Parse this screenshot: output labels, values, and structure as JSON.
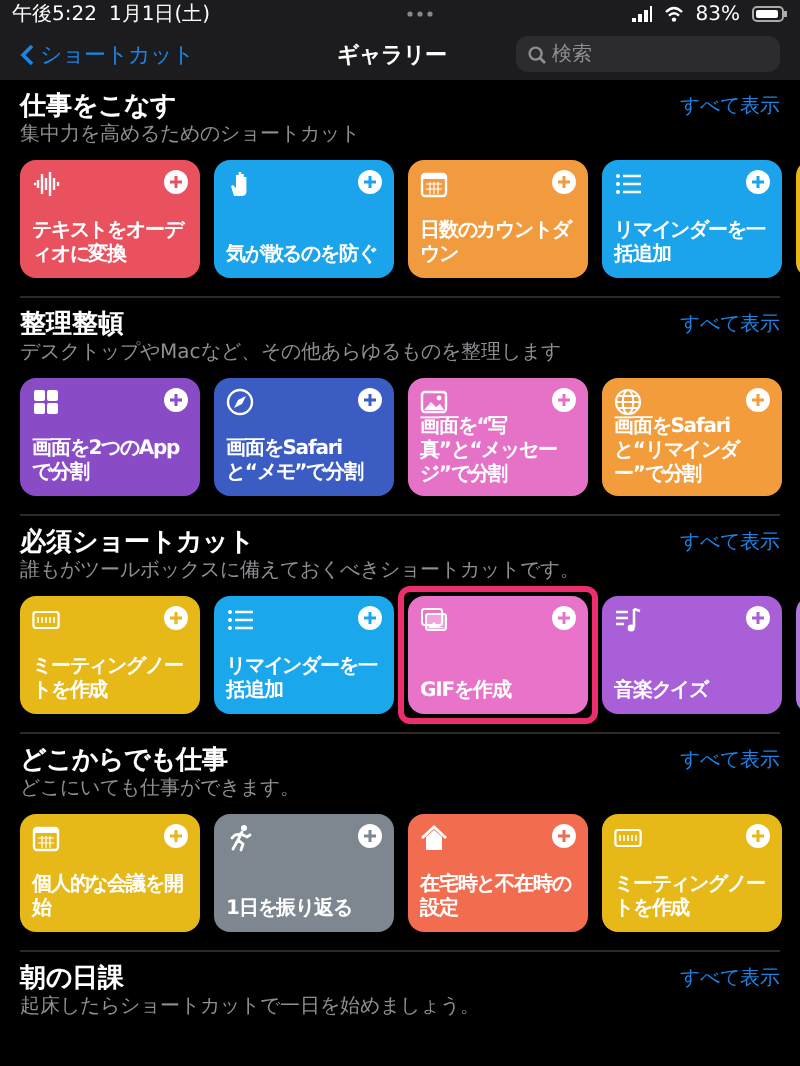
{
  "status_bar": {
    "time": "午後5:22",
    "date": "1月1日(土)",
    "battery": "83%"
  },
  "nav": {
    "back": "ショートカット",
    "title": "ギャラリー",
    "search": {
      "placeholder": "検索"
    }
  },
  "sections": [
    {
      "title": "仕事をこなす",
      "subtitle": "集中力を高めるためのショートカット",
      "see_all": "すべて表示",
      "cards": [
        {
          "kind": "full",
          "title": "テキストをオーディオに変換",
          "color": "#e9515e",
          "highlighted": false
        },
        {
          "kind": "full",
          "title": "気が散るのを防ぐ",
          "color": "#1ba4ec",
          "highlighted": false
        },
        {
          "kind": "full",
          "title": "日数のカウントダウン",
          "color": "#f19a3e",
          "highlighted": false
        },
        {
          "kind": "full",
          "title": "リマインダーを一括追加",
          "color": "#1ba4ec",
          "highlighted": false
        },
        {
          "kind": "peek",
          "color": "#e6b81a",
          "highlighted": false
        }
      ]
    },
    {
      "title": "整理整頓",
      "subtitle": "デスクトップやMacなど、その他あらゆるものを整理します",
      "see_all": "すべて表示",
      "cards": [
        {
          "kind": "full",
          "title": "画面を2つのAppで分割",
          "color": "#8a4cc6",
          "highlighted": false
        },
        {
          "kind": "full",
          "title": "画面をSafariと“メモ”で分割",
          "color": "#3b5cc2",
          "highlighted": false
        },
        {
          "kind": "full",
          "title": "画面を“写真”と“メッセージ”で分割",
          "color": "#e672c8",
          "highlighted": false
        },
        {
          "kind": "full",
          "title": "画面をSafariと“リマインダー”で分割",
          "color": "#f29c3c",
          "highlighted": false
        }
      ]
    },
    {
      "title": "必須ショートカット",
      "subtitle": "誰もがツールボックスに備えておくべきショートカットです。",
      "see_all": "すべて表示",
      "cards": [
        {
          "kind": "full",
          "title": "ミーティングノートを作成",
          "color": "#e6b818",
          "highlighted": false
        },
        {
          "kind": "full",
          "title": "リマインダーを一括追加",
          "color": "#1ba7ec",
          "highlighted": false
        },
        {
          "kind": "full",
          "title": "GIFを作成",
          "color": "#e873c8",
          "highlighted": true
        },
        {
          "kind": "full",
          "title": "音楽クイズ",
          "color": "#a95fd8",
          "highlighted": false
        },
        {
          "kind": "peek",
          "color": "#b07ad8",
          "highlighted": false
        }
      ]
    },
    {
      "title": "どこからでも仕事",
      "subtitle": "どこにいても仕事ができます。",
      "see_all": "すべて表示",
      "cards": [
        {
          "kind": "full",
          "title": "個人的な会議を開始",
          "color": "#e6b818",
          "highlighted": false
        },
        {
          "kind": "full",
          "title": "1日を振り返る",
          "color": "#7e8790",
          "highlighted": false
        },
        {
          "kind": "full",
          "title": "在宅時と不在時の設定",
          "color": "#f26c50",
          "highlighted": false
        },
        {
          "kind": "full",
          "title": "ミーティングノートを作成",
          "color": "#e6b818",
          "highlighted": false
        }
      ]
    },
    {
      "title": "朝の日課",
      "subtitle": "起床したらショートカットで一日を始めましょう。",
      "see_all": "すべて表示"
    }
  ]
}
